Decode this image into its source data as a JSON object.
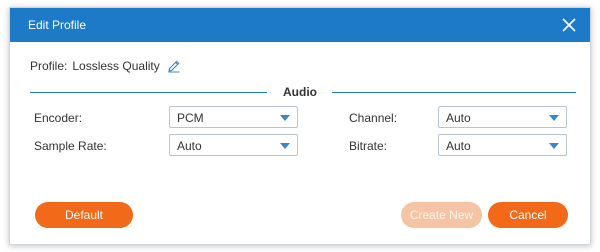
{
  "dialog": {
    "title": "Edit Profile",
    "close_icon": "close-icon"
  },
  "profile": {
    "label": "Profile:",
    "value": "Lossless Quality",
    "edit_icon": "pencil-icon"
  },
  "section": {
    "title": "Audio"
  },
  "fields": {
    "encoder": {
      "label": "Encoder:",
      "value": "PCM"
    },
    "sample_rate": {
      "label": "Sample Rate:",
      "value": "Auto"
    },
    "channel": {
      "label": "Channel:",
      "value": "Auto"
    },
    "bitrate": {
      "label": "Bitrate:",
      "value": "Auto"
    }
  },
  "buttons": {
    "default": "Default",
    "create_new": "Create New",
    "cancel": "Cancel"
  },
  "colors": {
    "titlebar": "#1d7ac8",
    "accent_orange": "#f2691a",
    "disabled_orange": "#f5c4a5",
    "dropdown_arrow": "#3a86c8"
  }
}
